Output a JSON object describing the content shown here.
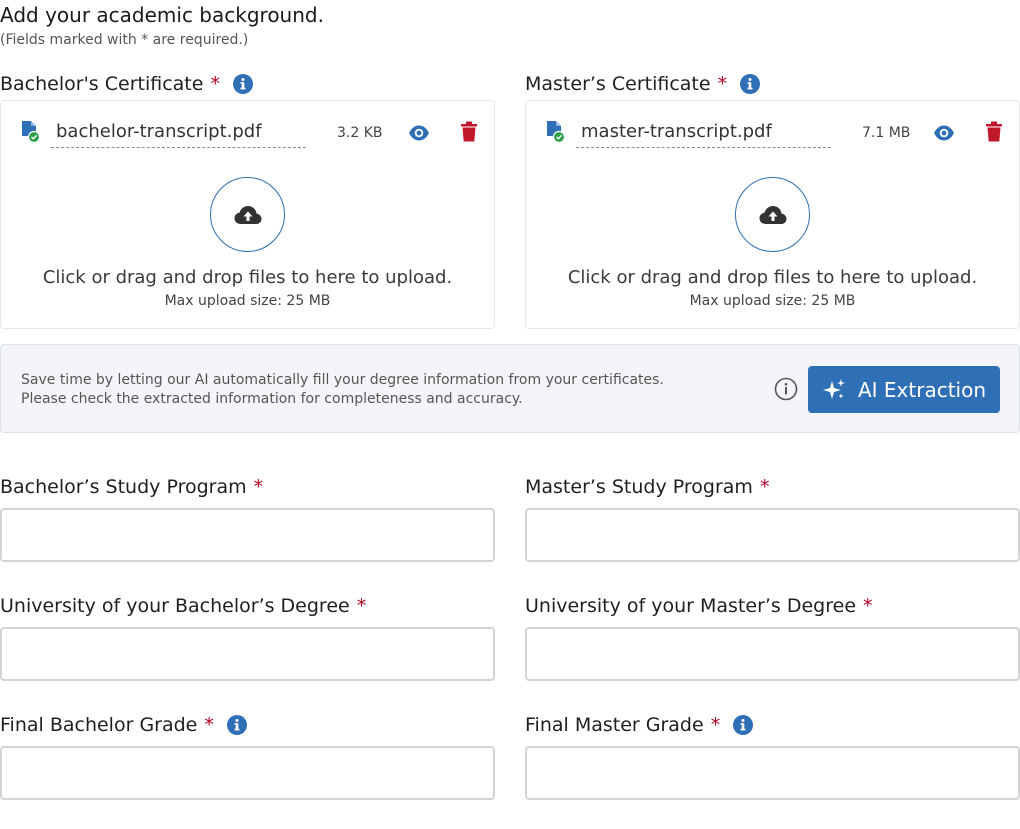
{
  "header": {
    "title": "Add your academic background.",
    "note": "(Fields marked with * are required.)"
  },
  "required_marker": "*",
  "upload_text": "Click or drag and drop files to here to upload.",
  "upload_max": "Max upload size: 25 MB",
  "bachelor_certificate": {
    "label": "Bachelor's Certificate",
    "file_name": "bachelor-transcript.pdf",
    "file_size": "3.2 KB"
  },
  "master_certificate": {
    "label": "Master’s Certificate",
    "file_name": "master-transcript.pdf",
    "file_size": "7.1 MB"
  },
  "ai": {
    "line1": "Save time by letting our AI automatically fill your degree information from your certificates.",
    "line2": "Please check the extracted information for completeness and accuracy.",
    "button_label": "AI Extraction"
  },
  "fields": {
    "bachelor_program": {
      "label": "Bachelor’s Study Program",
      "value": ""
    },
    "master_program": {
      "label": "Master’s Study Program",
      "value": ""
    },
    "bachelor_university": {
      "label": "University of your Bachelor’s Degree",
      "value": ""
    },
    "master_university": {
      "label": "University of your Master’s Degree",
      "value": ""
    },
    "bachelor_grade": {
      "label": "Final Bachelor Grade",
      "value": ""
    },
    "master_grade": {
      "label": "Final Master Grade",
      "value": ""
    }
  },
  "colors": {
    "accent": "#2f6fb6",
    "required": "#b00020",
    "delete": "#c0182a",
    "success": "#2e9e4b"
  }
}
